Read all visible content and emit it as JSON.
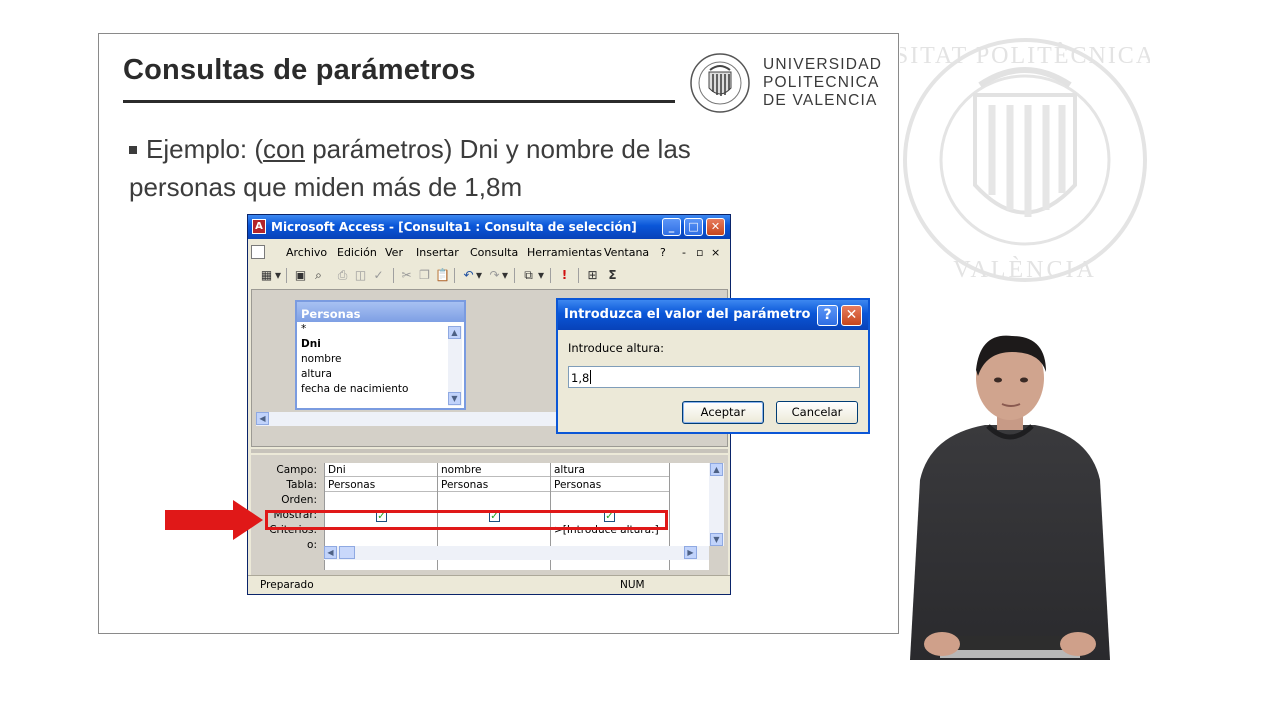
{
  "slide": {
    "title": "Consultas de parámetros",
    "logo_text": [
      "UNIVERSIDAD",
      "POLITECNICA",
      "DE VALENCIA"
    ],
    "bullet": {
      "prefix": "Ejemplo: (",
      "underlined": "con",
      "after": " parámetros) Dni y nombre de las",
      "line2": "personas que miden más de 1,8m"
    },
    "watermark_text": "UNIVERSITAT POLITÈCNICA DE VALÈNCIA"
  },
  "access": {
    "window_title": "Microsoft Access - [Consulta1 : Consulta de selección]",
    "title_buttons": [
      "_",
      "□",
      "✕"
    ],
    "menu": [
      "Archivo",
      "Edición",
      "Ver",
      "Insertar",
      "Consulta",
      "Herramientas",
      "Ventana",
      "?"
    ],
    "menu_right": [
      "-",
      "▫",
      "×"
    ],
    "table": {
      "name": "Personas",
      "fields": [
        "*",
        "Dni",
        "nombre",
        "altura",
        "fecha de nacimiento"
      ]
    },
    "grid": {
      "row_labels": [
        "Campo:",
        "Tabla:",
        "Orden:",
        "Mostrar:",
        "Criterios:",
        "o:"
      ],
      "columns": [
        {
          "campo": "Dni",
          "tabla": "Personas",
          "mostrar": true,
          "criterios": ""
        },
        {
          "campo": "nombre",
          "tabla": "Personas",
          "mostrar": true,
          "criterios": ""
        },
        {
          "campo": "altura",
          "tabla": "Personas",
          "mostrar": true,
          "criterios": ">[Introduce altura:]"
        }
      ]
    },
    "status": {
      "left": "Preparado",
      "right": "NUM"
    }
  },
  "dialog": {
    "title": "Introduzca el valor del parámetro",
    "help_button": "?",
    "close_button": "✕",
    "label": "Introduce altura:",
    "value": "1,8",
    "accept": "Aceptar",
    "cancel": "Cancelar"
  },
  "colors": {
    "highlight": "#e01818",
    "xp_title": "#0a56d8"
  }
}
